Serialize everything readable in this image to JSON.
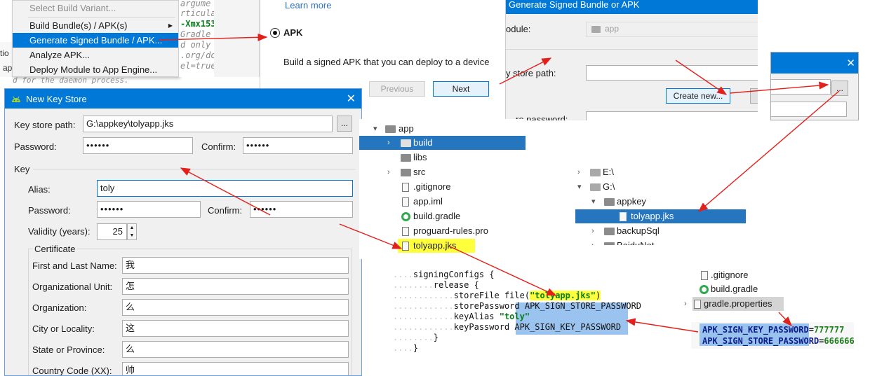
{
  "build_menu": {
    "items": [
      {
        "label": "Select Build Variant...",
        "disabled": true
      },
      {
        "label": "Build Bundle(s) / APK(s)",
        "has_submenu": true
      },
      {
        "label": "Generate Signed Bundle / APK...",
        "selected": true
      },
      {
        "label": "Analyze APK..."
      },
      {
        "label": "Deploy Module to App Engine..."
      }
    ],
    "submenu_arrow": "▶"
  },
  "edge_text": [
    "tio",
    "ap"
  ],
  "background_code": {
    "lines": [
      "argume",
      "rticula",
      "-Xmx153",
      "Gradle",
      "d only",
      ".org/do",
      "el=true"
    ],
    "daemon_text": "d for the daemon process."
  },
  "apk_panel": {
    "learn_more": "Learn more",
    "option": "APK",
    "description": "Build a signed APK that you can deploy to a device",
    "previous_button": "Previous",
    "next_button": "Next"
  },
  "generate_dialog": {
    "title": "Generate Signed Bundle or APK",
    "module_label": "odule:",
    "module_value": "app",
    "key_store_label": "y store path:",
    "create_new_button": "Create new...",
    "store_password_label": "re password:"
  },
  "choose_dialog": {
    "browse_button": "..."
  },
  "new_key_store": {
    "title": "New Key Store",
    "close": "✕",
    "key_store_path_label": "Key store path:",
    "key_store_path_value": "G:\\appkey\\tolyapp.jks",
    "browse_button": "...",
    "password_label": "Password:",
    "password_value": "••••••",
    "confirm_label": "Confirm:",
    "confirm_value": "••••••",
    "key_section": "Key",
    "alias_label": "Alias:",
    "alias_value": "toly",
    "key_password_label": "Password:",
    "key_password_value": "••••••",
    "key_confirm_label": "Confirm:",
    "key_confirm_value": "••••••",
    "validity_label": "Validity (years):",
    "validity_value": "25",
    "certificate_section": "Certificate",
    "cert_fields": [
      {
        "label": "First and Last Name:",
        "value": "我"
      },
      {
        "label": "Organizational Unit:",
        "value": "怎"
      },
      {
        "label": "Organization:",
        "value": "么"
      },
      {
        "label": "City or Locality:",
        "value": "这"
      },
      {
        "label": "State or Province:",
        "value": "么"
      },
      {
        "label": "Country Code (XX):",
        "value": "帅"
      }
    ]
  },
  "project_tree": {
    "rows": [
      {
        "label": "app",
        "type": "folder",
        "expanded": true,
        "indent": 0
      },
      {
        "label": "build",
        "type": "folder",
        "expanded": false,
        "indent": 1,
        "selected": true
      },
      {
        "label": "libs",
        "type": "folder",
        "indent": 1
      },
      {
        "label": "src",
        "type": "folder",
        "expanded": false,
        "indent": 1
      },
      {
        "label": ".gitignore",
        "type": "file",
        "indent": 1
      },
      {
        "label": "app.iml",
        "type": "file",
        "indent": 1
      },
      {
        "label": "build.gradle",
        "type": "gradle",
        "indent": 1
      },
      {
        "label": "proguard-rules.pro",
        "type": "file",
        "indent": 1
      },
      {
        "label": "tolyapp.jks",
        "type": "file",
        "indent": 1,
        "highlight": true
      }
    ]
  },
  "drive_tree": {
    "rows": [
      {
        "label": "E:\\",
        "indent": 0,
        "expanded": false
      },
      {
        "label": "G:\\",
        "indent": 0,
        "expanded": true
      },
      {
        "label": "appkey",
        "indent": 1,
        "expanded": true
      },
      {
        "label": "tolyapp.jks",
        "indent": 2,
        "selected": true
      },
      {
        "label": "backupSql",
        "indent": 1,
        "expanded": false
      },
      {
        "label": "BaiduNet",
        "indent": 1,
        "expanded": false
      }
    ]
  },
  "signing_code": {
    "line1": "signingConfigs {",
    "line2": "release {",
    "line3_prefix": "storeFile file(",
    "line3_string": "\"tolyapp.jks\"",
    "line3_suffix": ")",
    "line4_prefix": "storePassword ",
    "line4_value": "APK_SIGN_STORE_PASSWORD",
    "line5_prefix": "keyAlias ",
    "line5_string": "\"toly\"",
    "line6_prefix": "keyPassword ",
    "line6_value": "APK_SIGN_KEY_PASSWORD",
    "close1": "}",
    "close2": "}"
  },
  "props_tree": {
    "rows": [
      {
        "label": ".gitignore",
        "type": "file"
      },
      {
        "label": "build.gradle",
        "type": "gradle"
      },
      {
        "label": "gradle.properties",
        "type": "props",
        "highlight": true
      }
    ]
  },
  "gradle_properties": {
    "key1": "APK_SIGN_KEY_PASSWORD",
    "val1": "777777",
    "key2": "APK_SIGN_STORE_PASSWORD",
    "val2": "666666"
  },
  "colors": {
    "accent": "#0078d7",
    "selection": "#2675bf",
    "highlight_yellow": "#ffff3c",
    "highlight_blue": "#8ab8ec",
    "arrow_red": "#e3211c"
  }
}
